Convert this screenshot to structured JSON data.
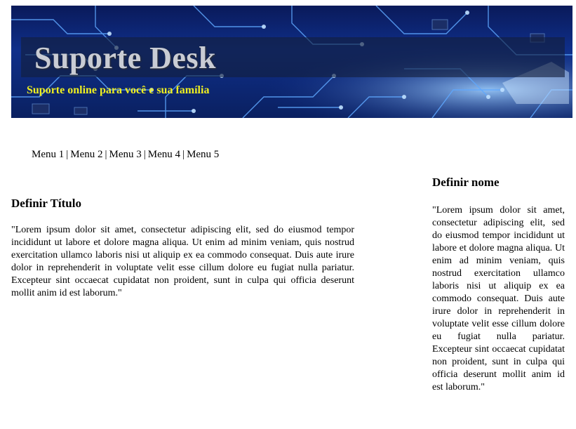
{
  "header": {
    "title": "Suporte Desk",
    "subtitle": "Suporte online para você e sua família",
    "banner_colors": {
      "base": "#0f2f8a",
      "trace": "#5fa8ff",
      "title": "#c9ccd4",
      "subtitle": "#f0f020"
    }
  },
  "nav": {
    "items": [
      {
        "label": "Menu 1"
      },
      {
        "label": "Menu 2"
      },
      {
        "label": "Menu 3"
      },
      {
        "label": "Menu 4"
      },
      {
        "label": "Menu 5"
      }
    ],
    "separator": "|"
  },
  "main": {
    "heading": "Definir Título",
    "text": "\"Lorem ipsum dolor sit amet, consectetur adipiscing elit, sed do eiusmod tempor incididunt ut labore et dolore magna aliqua. Ut enim ad minim veniam, quis nostrud exercitation ullamco laboris nisi ut aliquip ex ea commodo consequat. Duis aute irure dolor in reprehenderit in voluptate velit esse cillum dolore eu fugiat nulla pariatur. Excepteur sint occaecat cupidatat non proident, sunt in culpa qui officia deserunt mollit anim id est laborum.\""
  },
  "sidebar": {
    "heading": "Definir nome",
    "text": "\"Lorem ipsum dolor sit amet, consectetur adipiscing elit, sed do eiusmod tempor incididunt ut labore et dolore magna aliqua. Ut enim ad minim veniam, quis nostrud exercitation ullamco laboris nisi ut aliquip ex ea commodo consequat. Duis aute irure dolor in reprehenderit in voluptate velit esse cillum dolore eu fugiat nulla pariatur. Excepteur sint occaecat cupidatat non proident, sunt in culpa qui officia deserunt mollit anim id est laborum.\""
  }
}
